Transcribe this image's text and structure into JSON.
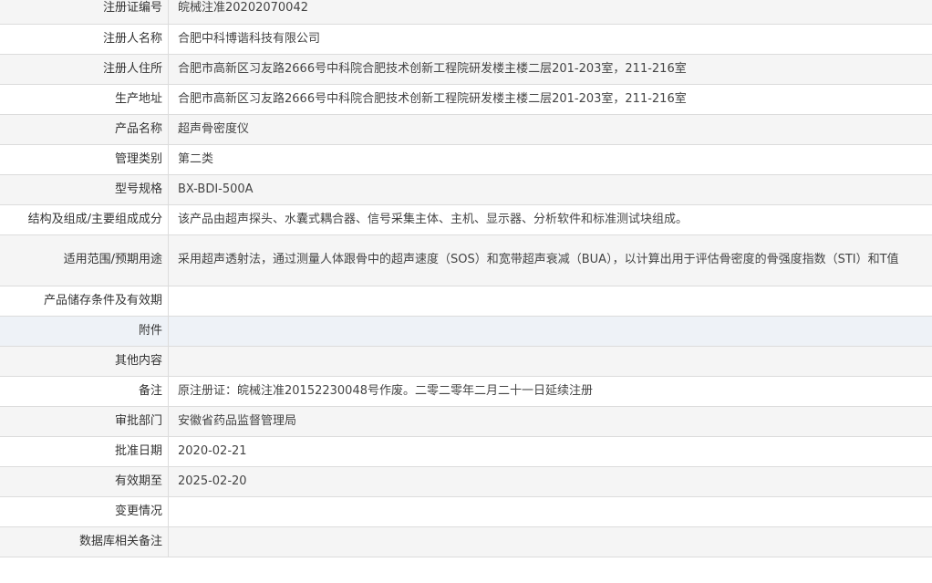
{
  "fields": [
    {
      "label": "注册证编号",
      "value": "皖械注准20202070042"
    },
    {
      "label": "注册人名称",
      "value": "合肥中科博谐科技有限公司"
    },
    {
      "label": "注册人住所",
      "value": "合肥市高新区习友路2666号中科院合肥技术创新工程院研发楼主楼二层201-203室，211-216室"
    },
    {
      "label": "生产地址",
      "value": "合肥市高新区习友路2666号中科院合肥技术创新工程院研发楼主楼二层201-203室，211-216室"
    },
    {
      "label": "产品名称",
      "value": "超声骨密度仪"
    },
    {
      "label": "管理类别",
      "value": "第二类"
    },
    {
      "label": "型号规格",
      "value": "BX-BDI-500A"
    },
    {
      "label": "结构及组成/主要组成成分",
      "value": "该产品由超声探头、水囊式耦合器、信号采集主体、主机、显示器、分析软件和标准测试块组成。"
    },
    {
      "label": "适用范围/预期用途",
      "value": "采用超声透射法，通过测量人体跟骨中的超声速度（SOS）和宽带超声衰减（BUA），以计算出用于评估骨密度的骨强度指数（STI）和T值"
    },
    {
      "label": "产品储存条件及有效期",
      "value": ""
    },
    {
      "label": "附件",
      "value": ""
    },
    {
      "label": "其他内容",
      "value": ""
    },
    {
      "label": "备注",
      "value": "原注册证：皖械注准20152230048号作废。二零二零年二月二十一日延续注册"
    },
    {
      "label": "审批部门",
      "value": "安徽省药品监督管理局"
    },
    {
      "label": "批准日期",
      "value": "2020-02-21"
    },
    {
      "label": "有效期至",
      "value": "2025-02-20"
    },
    {
      "label": "变更情况",
      "value": ""
    },
    {
      "label": "数据库相关备注",
      "value": ""
    }
  ]
}
